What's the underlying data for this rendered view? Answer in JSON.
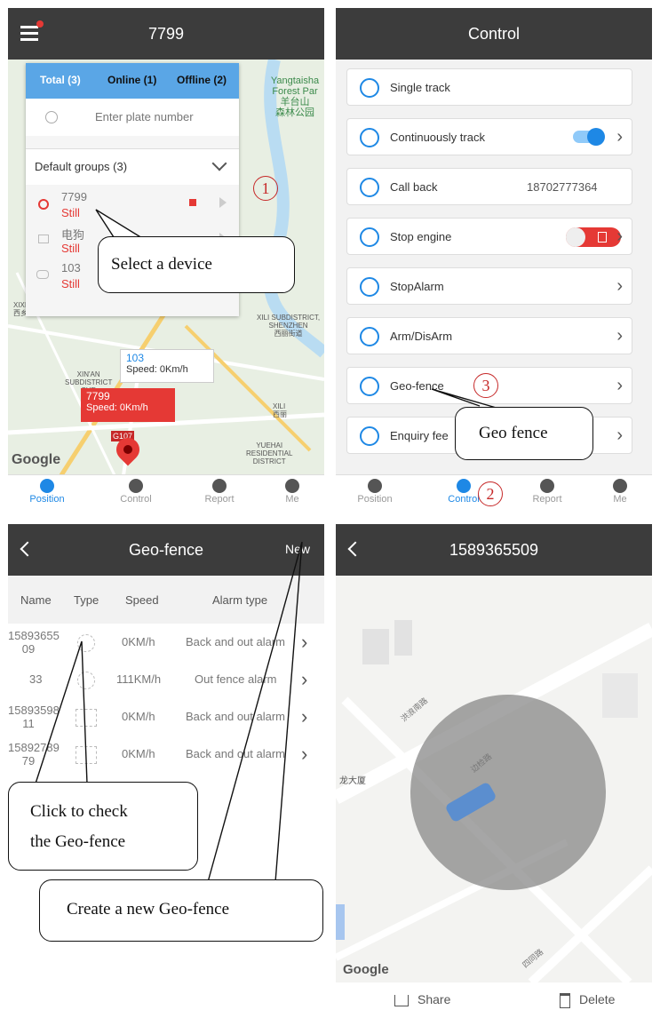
{
  "panel1": {
    "title": "7799",
    "tabs": {
      "total": "Total (3)",
      "online": "Online (1)",
      "offline": "Offline (2)"
    },
    "search_placeholder": "Enter plate number",
    "groups_label": "Default groups (3)",
    "devices": [
      {
        "name": "7799",
        "status": "Still"
      },
      {
        "name": "电狗",
        "status": "Still"
      },
      {
        "name": "103",
        "status": "Still"
      }
    ],
    "map_labels": {
      "yangtaishan": "Yangtaisha\nForest Par\n羊台山\n森林公园",
      "xixiang": "XIXIANG\n西乡",
      "xili_sub": "XILI SUBDISTRICT,\nSHENZHEN\n西丽街道",
      "xinan": "XIN'AN\nSUBDISTRICT\nSHE\n新",
      "xili": "XILI\n西丽",
      "yuehai": "YUEHAI\nRESIDENTIAL\nDISTRICT",
      "g107": "G107",
      "google": "Google"
    },
    "info_103": {
      "name": "103",
      "speed": "Speed: 0Km/h"
    },
    "info_7799": {
      "name": "7799",
      "speed": "Speed: 0Km/h"
    },
    "nav": [
      "Position",
      "Control",
      "Report",
      "Me"
    ]
  },
  "panel2": {
    "title": "Control",
    "rows": [
      {
        "label": "Single track"
      },
      {
        "label": "Continuously track"
      },
      {
        "label": "Call back",
        "value": "18702777364"
      },
      {
        "label": "Stop engine"
      },
      {
        "label": "StopAlarm"
      },
      {
        "label": "Arm/DisArm"
      },
      {
        "label": "Geo-fence"
      },
      {
        "label": "Enquiry fee"
      }
    ],
    "nav": [
      "Position",
      "Control",
      "Report",
      "Me"
    ]
  },
  "panel3": {
    "title": "Geo-fence",
    "new_label": "New",
    "headers": [
      "Name",
      "Type",
      "Speed",
      "Alarm type"
    ],
    "rows": [
      {
        "name": "15893655\n09",
        "speed": "0KM/h",
        "alarm": "Back and out alarm"
      },
      {
        "name": "33",
        "speed": "111KM/h",
        "alarm": "Out fence alarm"
      },
      {
        "name": "15893598\n11",
        "speed": "0KM/h",
        "alarm": "Back and out alarm"
      },
      {
        "name": "15892789\n79",
        "speed": "0KM/h",
        "alarm": "Back and out alarm"
      }
    ]
  },
  "panel4": {
    "title": "1589365509",
    "map_labels": {
      "road1": "洪浪南路",
      "road2": "边检路",
      "building": "龙大厦",
      "road3": "四同路",
      "google": "Google"
    },
    "share_label": "Share",
    "delete_label": "Delete"
  },
  "annotations": {
    "num1": "1",
    "num2": "2",
    "num3": "3",
    "select_device": "Select a device",
    "geo_fence": "Geo fence",
    "click_check_1": "Click to check",
    "click_check_2": "the Geo-fence",
    "create_new": "Create a new Geo-fence"
  },
  "colors": {
    "accent": "#1e88e5",
    "topbar": "#3c3c3c",
    "alert": "#e53935",
    "annotation": "#c62828"
  }
}
